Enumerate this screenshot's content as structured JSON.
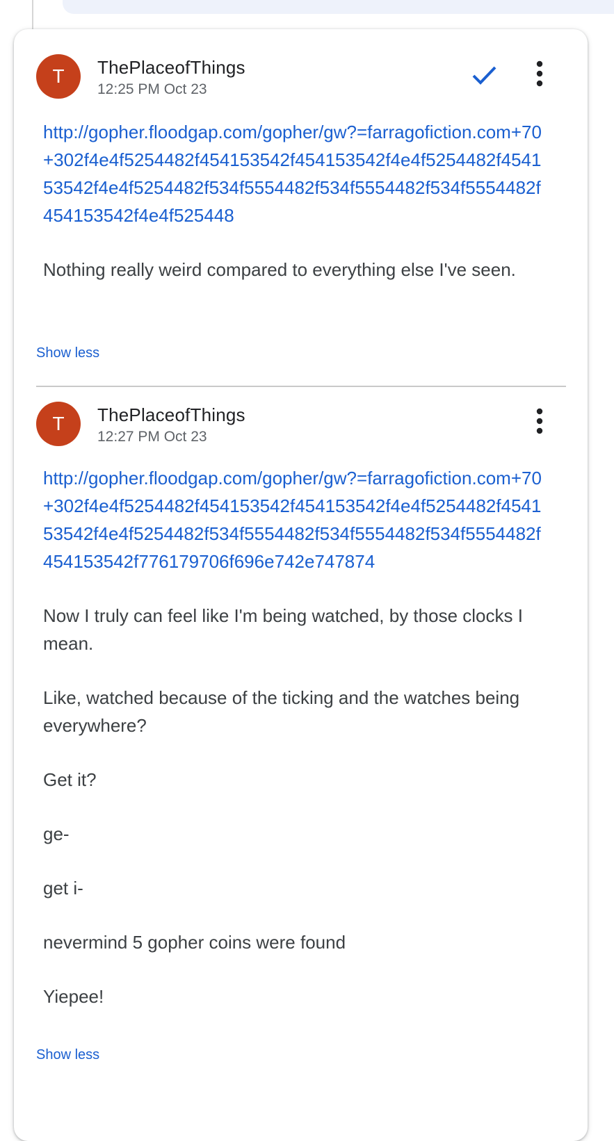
{
  "comments": [
    {
      "avatar_initial": "T",
      "author": "ThePlaceofThings",
      "time": "12:25 PM Oct 23",
      "link": "http://gopher.floodgap.com/gopher/gw?=farragofiction.com+70+302f4e4f5254482f454153542f454153542f4e4f5254482f454153542f4e4f5254482f534f5554482f534f5554482f534f5554482f454153542f4e4f525448",
      "paragraphs": [
        "Nothing really weird compared to everything else I've seen."
      ],
      "show_less": "Show less",
      "resolved_icon": "checkmark-icon",
      "more_icon": "more-vert-icon"
    },
    {
      "avatar_initial": "T",
      "author": "ThePlaceofThings",
      "time": "12:27 PM Oct 23",
      "link": "http://gopher.floodgap.com/gopher/gw?=farragofiction.com+70+302f4e4f5254482f454153542f454153542f4e4f5254482f454153542f4e4f5254482f534f5554482f534f5554482f534f5554482f454153542f776179706f696e742e747874",
      "paragraphs": [
        "Now I truly can feel like I'm being watched, by those clocks I mean.",
        "Like, watched because of the ticking and the watches being everywhere?",
        "Get it?",
        "ge-",
        "get i-",
        "nevermind 5 gopher coins were found",
        "Yiepee!"
      ],
      "show_less": "Show less",
      "more_icon": "more-vert-icon"
    }
  ],
  "colors": {
    "avatar": "#c5401b",
    "link": "#1a5fd0",
    "accent_check": "#1a5fd0"
  }
}
